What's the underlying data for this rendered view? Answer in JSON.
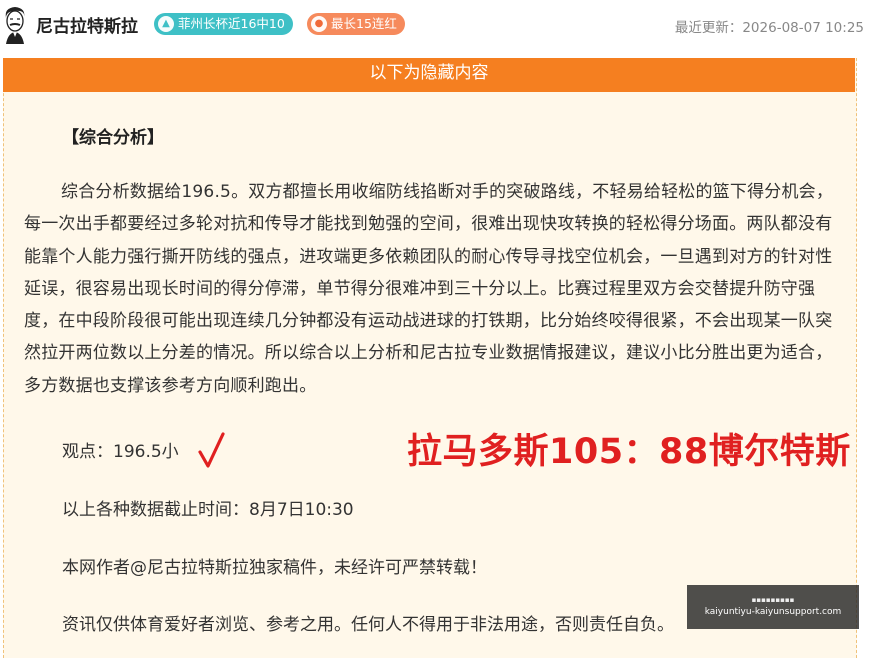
{
  "header": {
    "author": "尼古拉特斯拉",
    "badges": [
      {
        "text": "菲州长杯近16中10",
        "icon": "arrow-up-icon",
        "color": "#3ec0c6"
      },
      {
        "text": "最长15连红",
        "icon": "fire-icon",
        "color": "#f68a5c"
      }
    ],
    "updated": "最近更新：2026-08-07 10:25"
  },
  "banner": "以下为隐藏内容",
  "article": {
    "heading": "【综合分析】",
    "analysis": "综合分析数据给196.5。双方都擅长用收缩防线掐断对手的突破路线，不轻易给轻松的篮下得分机会，每一次出手都要经过多轮对抗和传导才能找到勉强的空间，很难出现快攻转换的轻松得分场面。两队都没有能靠个人能力强行撕开防线的强点，进攻端更多依赖团队的耐心传导寻找空位机会，一旦遇到对方的针对性延误，很容易出现长时间的得分停滞，单节得分很难冲到三十分以上。比赛过程里双方会交替提升防守强度，在中段阶段很可能出现连续几分钟都没有运动战进球的打铁期，比分始终咬得很紧，不会出现某一队突然拉开两位数以上分差的情况。所以综合以上分析和尼古拉专业数据情报建议，建议小比分胜出更为适合，多方数据也支撑该参考方向顺利跑出。",
    "viewpoint": "观点：196.5小",
    "result": "拉马多斯105：88博尔特斯",
    "cutoff": "以上各种数据截止时间：8月7日10:30",
    "copyright": "本网作者@尼古拉特斯拉独家稿件，未经许可严禁转载！",
    "disclaimer": "资讯仅供体育爱好者浏览、参考之用。任何人不得用于非法用途，否则责任自负。"
  },
  "watermark": {
    "top": "▪▪▪▪▪▪▪▪▪",
    "url": "kaiyuntiyu-kaiyunsupport.com"
  },
  "colors": {
    "accent": "#f57f20",
    "result": "#e02020",
    "panel": "#fff8ea"
  }
}
